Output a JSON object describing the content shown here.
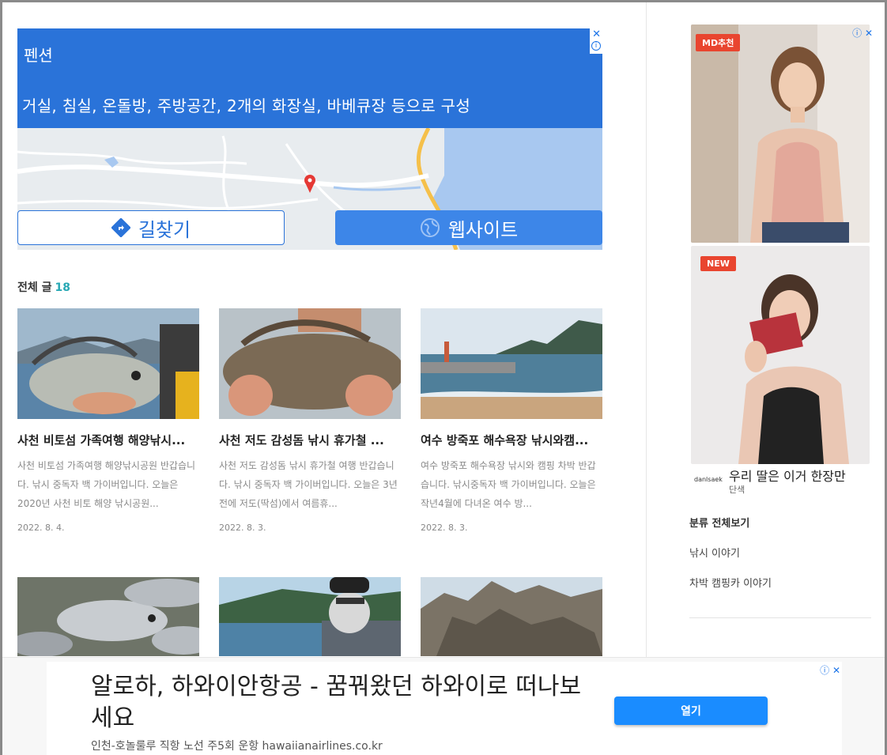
{
  "top_ad": {
    "title": "펜션",
    "description": "거실, 침실, 온돌방, 주방공간, 2개의 화장실, 바베큐장 등으로 구성",
    "directions_label": "길찾기",
    "website_label": "웹사이트",
    "close": "✕",
    "info": "i"
  },
  "posts_header": {
    "label": "전체 글",
    "count": "18"
  },
  "posts": [
    {
      "title": "사천 비토섬 가족여행 해양낚시...",
      "summary": "사천 비토섬 가족여행 해양낚시공원 반갑습니다. 낚시 중독자 백 가이버입니다. 오늘은 2020년 사천 비토 해양 낚시공원...",
      "date": "2022. 8. 4."
    },
    {
      "title": "사천 저도 감성돔 낚시 휴가철 ...",
      "summary": "사천 저도 감성돔 낚시 휴가철 여행 반갑습니다. 낚시 중독자 백 가이버입니다. 오늘은 3년 전에 저도(딱섬)에서 여름휴...",
      "date": "2022. 8. 3."
    },
    {
      "title": "여수 방죽포 해수욕장 낚시와캠...",
      "summary": "여수 방죽포 해수욕장 낚시와 캠핑 차박 반갑습니다. 낚시중독자 백 가이버입니다. 오늘은 작년4월에 다녀온 여수 방...",
      "date": "2022. 8. 3."
    }
  ],
  "right_ad": {
    "badge1": "MD추천",
    "badge2": "NEW",
    "caption": "우리 딸은 이거 한장만",
    "sub": "단색",
    "logo": "danlsaek",
    "icons": "ⓘ ✕"
  },
  "categories": {
    "header": "분류 전체보기",
    "items": [
      "낚시 이야기",
      "차박 캠핑카 이야기"
    ]
  },
  "bottom_ad": {
    "headline": "알로하, 하와이안항공 - 꿈꿔왔던 하와이로 떠나보세요",
    "url": "인천-호놀룰루 직항 노선 주5회 운항 hawaiianairlines.co.kr",
    "open_label": "열기",
    "icons": "ⓘ ✕"
  }
}
